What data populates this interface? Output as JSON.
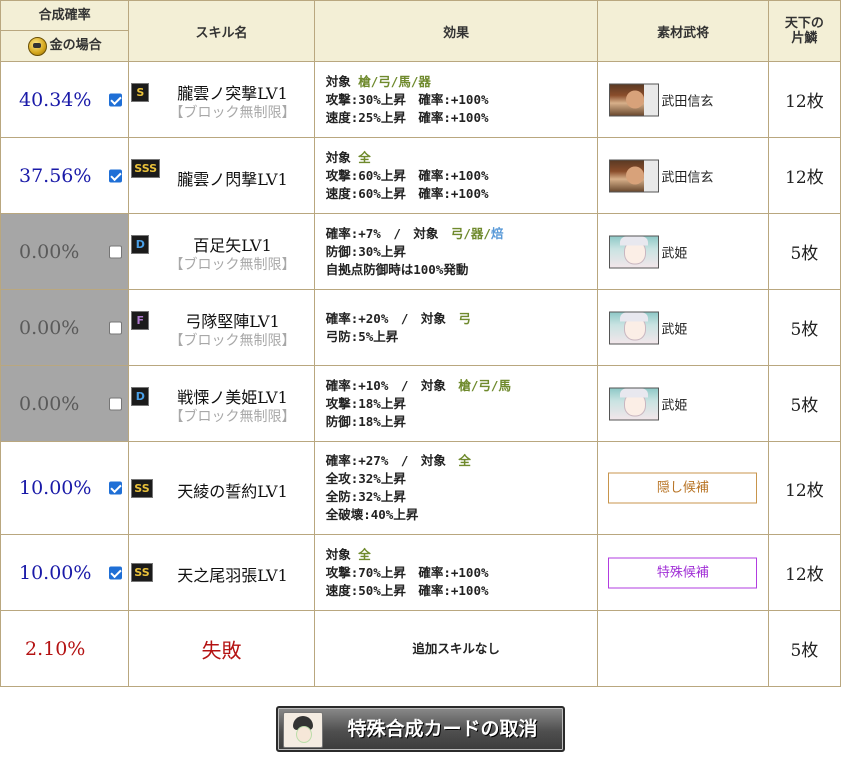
{
  "header": {
    "rate_title": "合成確率",
    "gold_label": "金の場合",
    "skill_title": "スキル名",
    "effect_title": "効果",
    "material_title": "素材武将",
    "fragment_title_1": "天下の",
    "fragment_title_2": "片鱗"
  },
  "rows": [
    {
      "rate": "40.34%",
      "skill": "朧雲ノ突撃LV1",
      "rank": "S",
      "sub": "【ブロック無制限】",
      "material": "武田信玄",
      "fragments": "12枚"
    },
    {
      "rate": "37.56%",
      "skill": "朧雲ノ閃撃LV1",
      "rank": "SSS",
      "sub": "",
      "material": "武田信玄",
      "fragments": "12枚"
    },
    {
      "rate": "0.00%",
      "skill": "百足矢LV1",
      "rank": "D",
      "sub": "【ブロック無制限】",
      "material": "武姫",
      "fragments": "5枚"
    },
    {
      "rate": "0.00%",
      "skill": "弓隊堅陣LV1",
      "rank": "F",
      "sub": "【ブロック無制限】",
      "material": "武姫",
      "fragments": "5枚"
    },
    {
      "rate": "0.00%",
      "skill": "戦慄ノ美姫LV1",
      "rank": "D",
      "sub": "【ブロック無制限】",
      "material": "武姫",
      "fragments": "5枚"
    },
    {
      "rate": "10.00%",
      "skill": "天綾の誓約LV1",
      "rank": "SS",
      "sub": "",
      "material": "隠し候補",
      "fragments": "12枚"
    },
    {
      "rate": "10.00%",
      "skill": "天之尾羽張LV1",
      "rank": "SS",
      "sub": "",
      "material": "特殊候補",
      "fragments": "12枚"
    },
    {
      "rate": "2.10%",
      "skill": "失敗",
      "effect": "追加スキルなし",
      "fragments": "5枚"
    }
  ],
  "effects": {
    "r0": {
      "l1_a": "対象 ",
      "l1_b": "槍/弓/馬/器",
      "l2": "攻撃:30%上昇　確率:+100%",
      "l3": "速度:25%上昇　確率:+100%"
    },
    "r1": {
      "l1_a": "対象 ",
      "l1_b": "全",
      "l2": "攻撃:60%上昇　確率:+100%",
      "l3": "速度:60%上昇　確率:+100%"
    },
    "r2": {
      "l1_a": "確率:+7%　/　対象　",
      "l1_b": "弓/器/",
      "l1_c": "焙",
      "l2": "防御:30%上昇",
      "l3": "自拠点防御時は100%発動"
    },
    "r3": {
      "l1_a": "確率:+20%　/　対象　",
      "l1_b": "弓",
      "l2": "弓防:5%上昇"
    },
    "r4": {
      "l1_a": "確率:+10%　/　対象　",
      "l1_b": "槍/弓/馬",
      "l2": "攻撃:18%上昇",
      "l3": "防御:18%上昇"
    },
    "r5": {
      "l1_a": "確率:+27%　/　対象　",
      "l1_b": "全",
      "l2": "全攻:32%上昇",
      "l3": "全防:32%上昇",
      "l4": "全破壊:40%上昇"
    },
    "r6": {
      "l1_a": "対象 ",
      "l1_b": "全",
      "l2": "攻撃:70%上昇　確率:+100%",
      "l3": "速度:50%上昇　確率:+100%"
    }
  },
  "checkbox_states": [
    true,
    true,
    false,
    false,
    false,
    true,
    true
  ],
  "colors": {
    "rate_blue": "#1a1aa8",
    "fail_red": "#b41212",
    "header_bg": "#f3efd6",
    "disabled_grey": "#a6a6a6",
    "target_green": "#6f8a2d"
  },
  "cancel_button": {
    "label": "特殊合成カードの取消"
  }
}
